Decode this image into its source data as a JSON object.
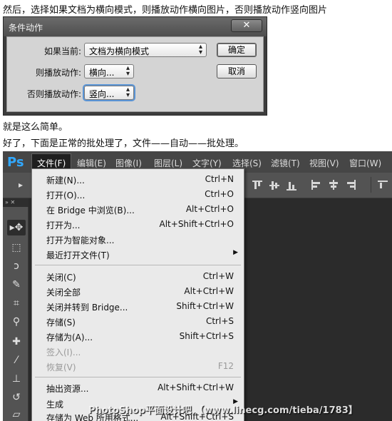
{
  "text": {
    "line1": "然后，选择如果文档为横向模式，则播放动作横向图片，否则播放动作竖向图片",
    "line2": "就是这么简单。",
    "line3": "好了，下面是正常的批处理了，文件——自动——批处理。"
  },
  "dialog": {
    "title": "条件动作",
    "close_glyph": "✕",
    "if_label": "如果当前:",
    "if_value": "文档为横向模式",
    "then_label": "则播放动作:",
    "then_value": "横向...",
    "else_label": "否则播放动作:",
    "else_value": "竖向...",
    "ok_label": "确定",
    "cancel_label": "取消"
  },
  "ps": {
    "logo": "Ps",
    "menu": [
      "文件(F)",
      "编辑(E)",
      "图像(I)",
      "图层(L)",
      "文字(Y)",
      "选择(S)",
      "滤镜(T)",
      "视图(V)",
      "窗口(W)"
    ],
    "toolbox_head": "»  ✕",
    "file_menu": [
      {
        "label": "新建(N)...",
        "shortcut": "Ctrl+N"
      },
      {
        "label": "打开(O)...",
        "shortcut": "Ctrl+O"
      },
      {
        "label": "在 Bridge 中浏览(B)...",
        "shortcut": "Alt+Ctrl+O"
      },
      {
        "label": "打开为...",
        "shortcut": "Alt+Shift+Ctrl+O"
      },
      {
        "label": "打开为智能对象...",
        "shortcut": ""
      },
      {
        "label": "最近打开文件(T)",
        "shortcut": ""
      },
      {
        "label": "关闭(C)",
        "shortcut": "Ctrl+W"
      },
      {
        "label": "关闭全部",
        "shortcut": "Alt+Ctrl+W"
      },
      {
        "label": "关闭并转到 Bridge...",
        "shortcut": "Shift+Ctrl+W"
      },
      {
        "label": "存储(S)",
        "shortcut": "Ctrl+S"
      },
      {
        "label": "存储为(A)...",
        "shortcut": "Shift+Ctrl+S"
      },
      {
        "label": "签入(I)...",
        "shortcut": ""
      },
      {
        "label": "恢复(V)",
        "shortcut": "F12"
      },
      {
        "label": "抽出资源...",
        "shortcut": "Alt+Shift+Ctrl+W"
      },
      {
        "label": "生成",
        "shortcut": ""
      },
      {
        "label": "存储为 Web 所用格式...",
        "shortcut": "Alt+Shift+Ctrl+S"
      }
    ],
    "watermark": "PhotoShop平面设计吧 【www.linecg.com/tieba/1783】"
  }
}
